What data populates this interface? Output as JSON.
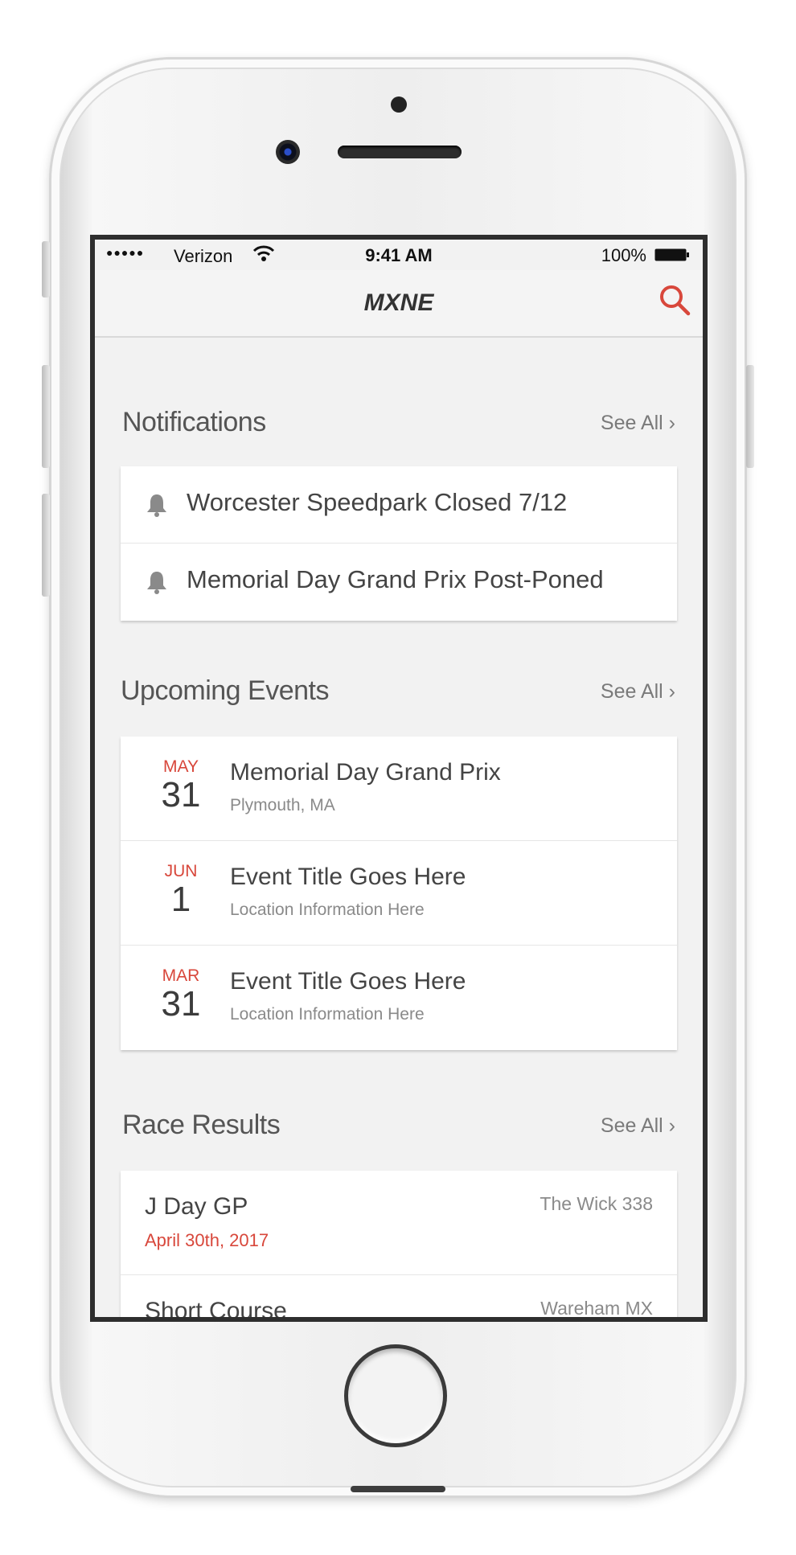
{
  "status_bar": {
    "signal": "●●●●●",
    "carrier": "Verizon",
    "time": "9:41 AM",
    "battery": "100%"
  },
  "nav": {
    "title": "MXNE",
    "search_icon": "search-icon"
  },
  "notifications": {
    "title": "Notifications",
    "see_all": "See All ›",
    "items": [
      {
        "text": "Worcester Speedpark Closed 7/12",
        "icon": "bell-icon"
      },
      {
        "text": "Memorial Day Grand Prix Post-Poned",
        "icon": "bell-icon"
      }
    ]
  },
  "events": {
    "title": "Upcoming Events",
    "see_all": "See All ›",
    "items": [
      {
        "month": "MAY",
        "day": "31",
        "title": "Memorial Day Grand Prix",
        "location": "Plymouth, MA"
      },
      {
        "month": "JUN",
        "day": "1",
        "title": "Event Title Goes Here",
        "location": "Location Information Here"
      },
      {
        "month": "MAR",
        "day": "31",
        "title": "Event Title Goes Here",
        "location": "Location Information Here"
      }
    ]
  },
  "results": {
    "title": "Race Results",
    "see_all": "See All ›",
    "items": [
      {
        "title": "J Day GP",
        "date": "April 30th, 2017",
        "venue": "The Wick 338"
      },
      {
        "title": "Short Course",
        "date": "",
        "venue": "Wareham MX"
      }
    ]
  },
  "colors": {
    "accent": "#d8473b",
    "background": "#f2f2f2",
    "card": "#ffffff"
  }
}
